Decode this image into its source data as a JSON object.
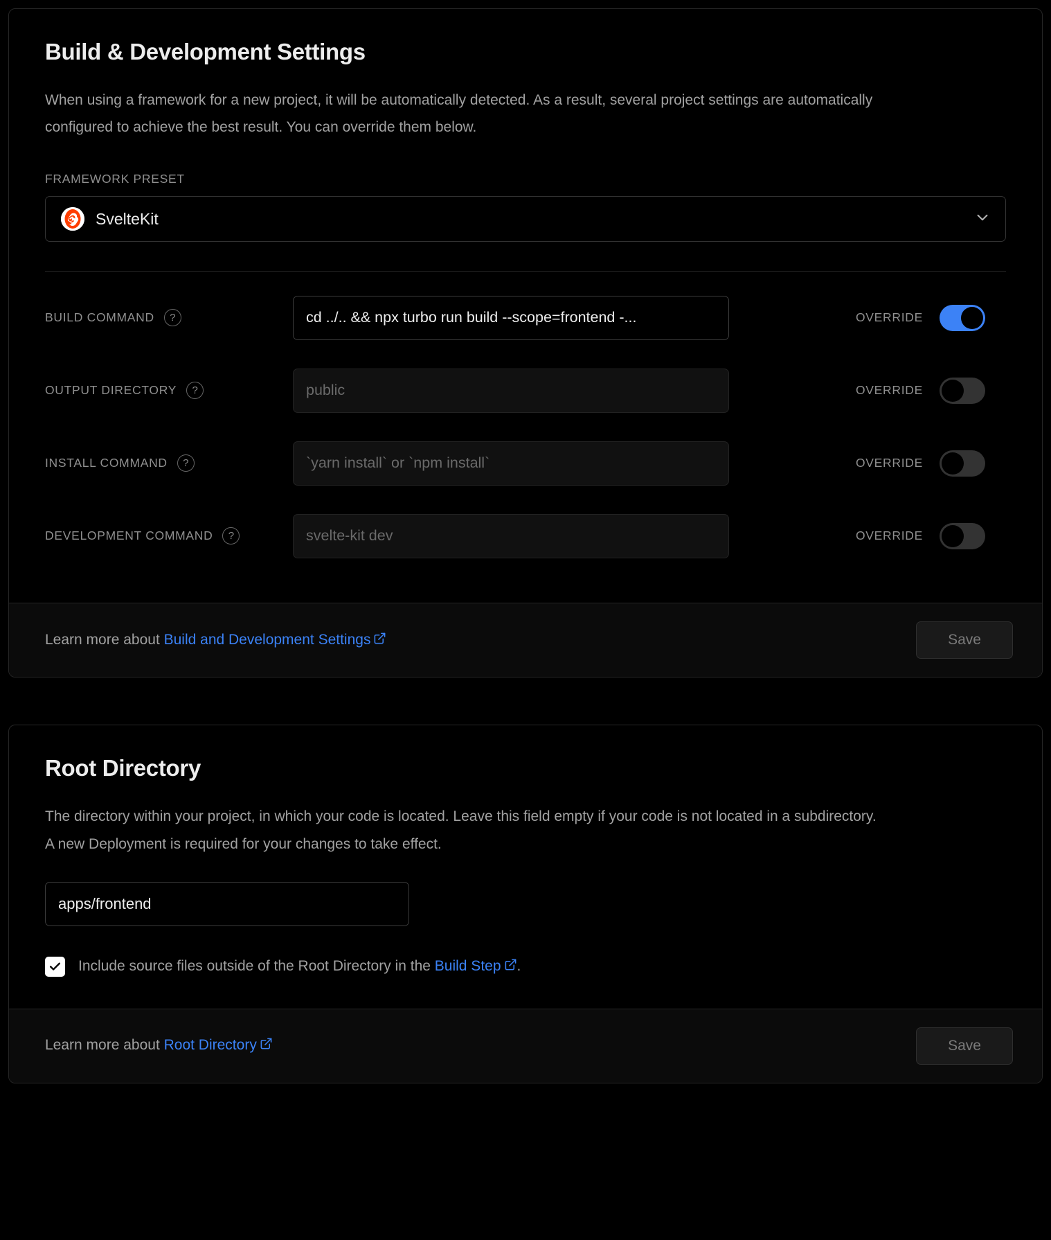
{
  "build_card": {
    "title": "Build & Development Settings",
    "description": "When using a framework for a new project, it will be automatically detected. As a result, several project settings are automatically configured to achieve the best result. You can override them below.",
    "preset": {
      "label": "FRAMEWORK PRESET",
      "selected": "SvelteKit",
      "logo": "sveltekit-logo",
      "chevron": "chevron-down-icon",
      "accent": "#ff3e00"
    },
    "rows": [
      {
        "label": "BUILD COMMAND",
        "help": "?",
        "value": "cd ../.. && npx turbo run build --scope=frontend -...",
        "placeholder": "",
        "override_label": "OVERRIDE",
        "override_on": true
      },
      {
        "label": "OUTPUT DIRECTORY",
        "help": "?",
        "value": "",
        "placeholder": "public",
        "override_label": "OVERRIDE",
        "override_on": false
      },
      {
        "label": "INSTALL COMMAND",
        "help": "?",
        "value": "",
        "placeholder": "`yarn install` or `npm install`",
        "override_label": "OVERRIDE",
        "override_on": false
      },
      {
        "label": "DEVELOPMENT COMMAND",
        "help": "?",
        "value": "",
        "placeholder": "svelte-kit dev",
        "override_label": "OVERRIDE",
        "override_on": false
      }
    ],
    "footer": {
      "learn_prefix": "Learn more about ",
      "link_text": "Build and Development Settings",
      "save_label": "Save"
    }
  },
  "root_card": {
    "title": "Root Directory",
    "description": "The directory within your project, in which your code is located. Leave this field empty if your code is not located in a subdirectory. A new Deployment is required for your changes to take effect.",
    "input_value": "apps/frontend",
    "input_placeholder": "",
    "checkbox": {
      "checked": true,
      "text_before": "Include source files outside of the Root Directory in the ",
      "link_text": "Build Step",
      "text_after": "."
    },
    "footer": {
      "learn_prefix": "Learn more about ",
      "link_text": "Root Directory",
      "save_label": "Save"
    }
  },
  "colors": {
    "accent_blue": "#3b82f6",
    "toggle_on": "#3c82f6",
    "svelte_orange": "#ff3e00"
  }
}
